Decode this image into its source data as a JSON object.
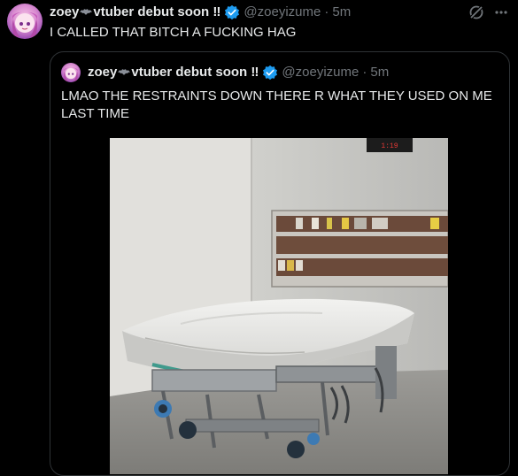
{
  "tweet": {
    "display_name": "zoey",
    "display_name_suffix": "vtuber debut soon ‼",
    "handle": "@zoeyizume",
    "separator": "·",
    "time": "5m",
    "text": "I CALLED THAT BITCH A FUCKING HAG"
  },
  "quote": {
    "display_name": "zoey",
    "display_name_suffix": "vtuber debut soon ‼",
    "handle": "@zoeyizume",
    "separator": "·",
    "time": "5m",
    "text": "LMAO THE RESTRAINTS DOWN THERE R WHAT THEY USED ON ME LAST TIME",
    "clock_readout": "1:19"
  },
  "icons": {
    "verified": "verified-badge-icon",
    "bat": "bat-emoji-icon",
    "grok": "grok-icon",
    "more": "more-dots-icon"
  },
  "colors": {
    "background": "#000000",
    "text_primary": "#e7e9ea",
    "text_secondary": "#71767b",
    "verified_blue": "#1d9bf0",
    "border": "#2f3336"
  }
}
